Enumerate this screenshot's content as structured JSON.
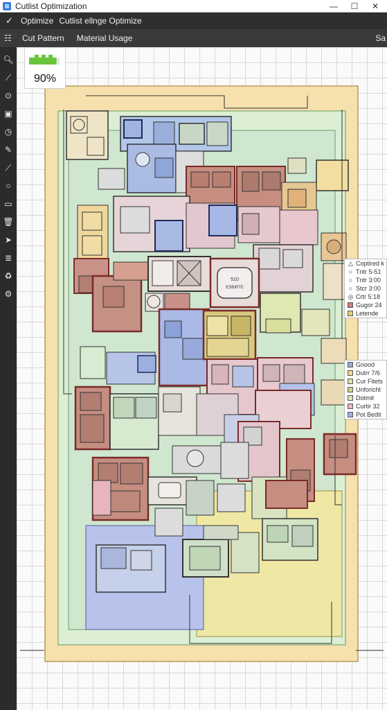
{
  "window": {
    "title": "Cutlist Optimization",
    "minimize": "—",
    "maximize": "☐",
    "close": "✕"
  },
  "menubar": {
    "items": [
      "Optimize",
      "Cutlist ellnge Optimize"
    ]
  },
  "tabs": {
    "items": [
      "Cut Pattern",
      "Material Usage"
    ],
    "overflow": "Sa"
  },
  "toolbar": {
    "tools": [
      "zoom-icon",
      "wand-icon",
      "target-icon",
      "square-icon",
      "timer-icon",
      "pencil-icon",
      "knife-icon",
      "circle-icon",
      "ruler-icon",
      "trash-icon",
      "arrow-icon",
      "layers-icon",
      "recycle-icon",
      "gear-icon"
    ]
  },
  "zoom": {
    "label": "90%",
    "fill": 0.9,
    "color": "#69c63c"
  },
  "center_panel": {
    "line1": "510",
    "line2": "ESBIRTE"
  },
  "legend_top": {
    "items": [
      {
        "symbol": "△",
        "label": "Coptired k"
      },
      {
        "symbol": "○",
        "label": "Tntr 5-51"
      },
      {
        "symbol": "○",
        "label": "Tntr 3:00"
      },
      {
        "symbol": "○",
        "label": "Stcr 3:00"
      },
      {
        "symbol": "◎",
        "label": "Crtr 5:18"
      },
      {
        "color": "#d47a7a",
        "label": "Gugor 24"
      },
      {
        "color": "#e2cf6a",
        "label": "Letende"
      }
    ]
  },
  "legend_bottom": {
    "items": [
      {
        "color": "#9aa9d8",
        "label": "Gnood"
      },
      {
        "color": "#f0d792",
        "label": "Dutrr 7/6"
      },
      {
        "color": "#d9e39a",
        "label": "Cur Fitets"
      },
      {
        "color": "#c9d98a",
        "label": "Unforicht"
      },
      {
        "color": "#d7e7b0",
        "label": "Dotmit"
      },
      {
        "color": "#e8b7b7",
        "label": "Curtir 32"
      },
      {
        "color": "#9fb0e3",
        "label": "Pot Bedit"
      }
    ]
  },
  "colors": {
    "toolbar": "#2b2b2b",
    "sheet": "#f6dda8",
    "inner_sheet": "#d6ecd0",
    "panel_blue": "#a9b9e6",
    "panel_red": "#c98c7f",
    "panel_pink": "#e8b2ba",
    "panel_green": "#bfe0b2",
    "panel_yellow": "#efe0a0",
    "panel_gray": "#dedede",
    "outline_red": "#8a2a2a"
  }
}
